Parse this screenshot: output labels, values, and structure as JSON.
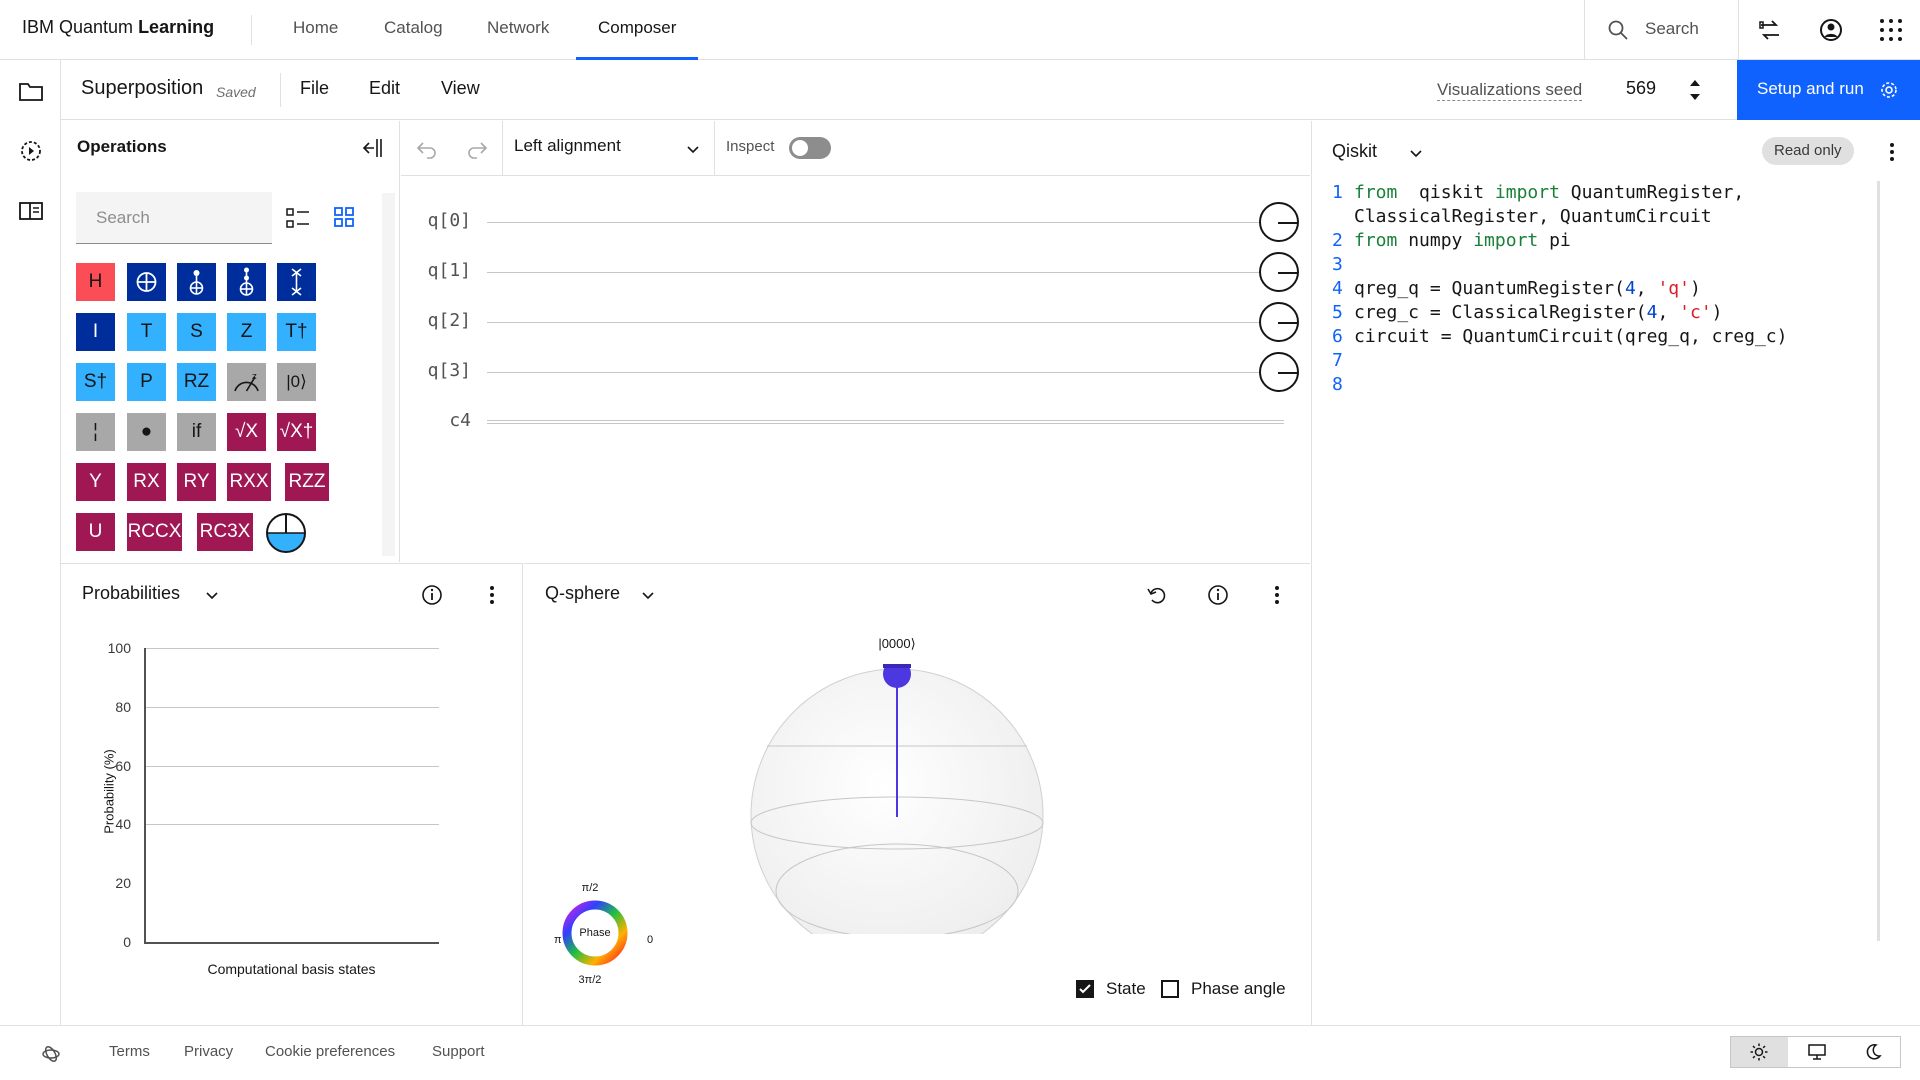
{
  "header": {
    "brand_prefix": "IBM Quantum",
    "brand_bold": "Learning",
    "nav": [
      "Home",
      "Catalog",
      "Network",
      "Composer"
    ],
    "active_nav": "Composer",
    "search_label": "Search"
  },
  "filebar": {
    "circuit_name": "Superposition",
    "save_status": "Saved",
    "menus": [
      "File",
      "Edit",
      "View"
    ],
    "seed_label": "Visualizations seed",
    "seed_value": "569",
    "run_label": "Setup and run"
  },
  "operations": {
    "title": "Operations",
    "search_placeholder": "Search",
    "gates": [
      [
        "H",
        "⊕",
        "⊕",
        "⊕",
        "x"
      ],
      [
        "I",
        "T",
        "S",
        "Z",
        "T†"
      ],
      [
        "S†",
        "P",
        "RZ",
        "",
        "|0⟩"
      ],
      [
        "¦",
        "●",
        "if",
        "√X",
        "√X†"
      ],
      [
        "Y",
        "RX",
        "RY",
        "RXX",
        "RZZ"
      ],
      [
        "U",
        "RCCX",
        "RC3X",
        ""
      ]
    ]
  },
  "circuit": {
    "alignment": "Left alignment",
    "inspect_label": "Inspect",
    "qubits": [
      "q[0]",
      "q[1]",
      "q[2]",
      "q[3]"
    ],
    "classical": "c4"
  },
  "code": {
    "language": "Qiskit",
    "badge": "Read only",
    "lines": [
      {
        "n": "1",
        "parts": [
          [
            "kw",
            "from"
          ],
          [
            "",
            "  qiskit "
          ],
          [
            "kw",
            "import"
          ],
          [
            "",
            " QuantumRegister,"
          ]
        ]
      },
      {
        "n": "",
        "parts": [
          [
            "",
            "ClassicalRegister, QuantumCircuit"
          ]
        ]
      },
      {
        "n": "2",
        "parts": [
          [
            "kw",
            "from"
          ],
          [
            "",
            " numpy "
          ],
          [
            "kw",
            "import"
          ],
          [
            "",
            " pi"
          ]
        ]
      },
      {
        "n": "3",
        "parts": []
      },
      {
        "n": "4",
        "parts": [
          [
            "",
            "qreg_q = QuantumRegister("
          ],
          [
            "num",
            "4"
          ],
          [
            "",
            ", "
          ],
          [
            "str",
            "'q'"
          ],
          [
            "",
            ")"
          ]
        ]
      },
      {
        "n": "5",
        "parts": [
          [
            "",
            "creg_c = ClassicalRegister("
          ],
          [
            "num",
            "4"
          ],
          [
            "",
            ", "
          ],
          [
            "str",
            "'c'"
          ],
          [
            "",
            ")"
          ]
        ]
      },
      {
        "n": "6",
        "parts": [
          [
            "",
            "circuit = QuantumCircuit(qreg_q, creg_c)"
          ]
        ]
      },
      {
        "n": "7",
        "parts": []
      },
      {
        "n": "8",
        "parts": []
      }
    ]
  },
  "probabilities": {
    "title": "Probabilities",
    "ylabel": "Probability (%)",
    "xlabel": "Computational basis states",
    "yticks": [
      "100",
      "80",
      "60",
      "40",
      "20",
      "0"
    ]
  },
  "qsphere": {
    "title": "Q-sphere",
    "state_label": "|0000⟩",
    "phase_label": "Phase",
    "phase_ticks": {
      "top": "π/2",
      "left": "π",
      "right": "0",
      "bottom": "3π/2"
    },
    "state_checkbox": "State",
    "state_checked": true,
    "phase_checkbox": "Phase angle",
    "phase_checked": false
  },
  "footer": {
    "links": [
      "Terms",
      "Privacy",
      "Cookie preferences",
      "Support"
    ]
  },
  "colors": {
    "primary": "#0f62fe",
    "gate_h": "#fa4d56",
    "gate_navy": "#002d9c",
    "gate_sky": "#33b1ff",
    "gate_gray": "#a8a8a8",
    "gate_magenta": "#9f1853",
    "state_blue": "#4c37e0"
  }
}
